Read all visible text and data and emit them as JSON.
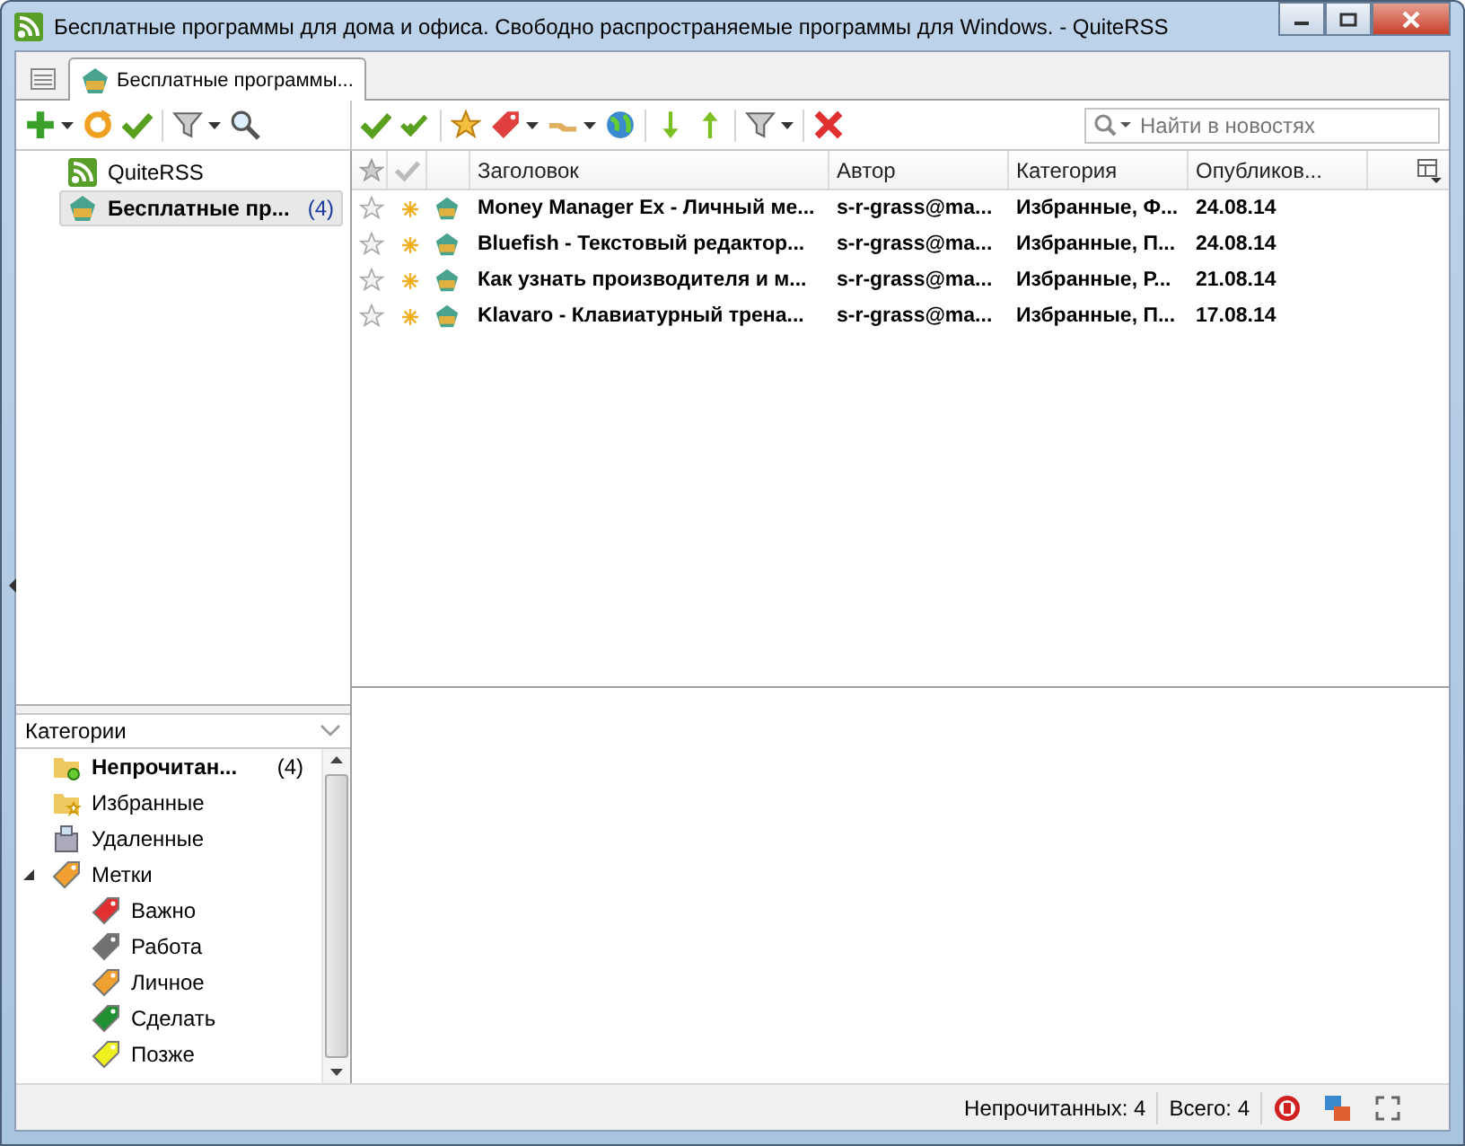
{
  "window": {
    "title": "Бесплатные программы для дома и офиса. Свободно распространяемые программы для Windows. - QuiteRSS"
  },
  "tabs": [
    {
      "label": "Бесплатные программы...",
      "selected": true
    }
  ],
  "search": {
    "placeholder": "Найти в новостях"
  },
  "feeds": [
    {
      "title": "QuiteRSS",
      "kind": "rss",
      "selected": false,
      "unread": false
    },
    {
      "title": "Бесплатные пр...",
      "count": "(4)",
      "kind": "site",
      "selected": true,
      "unread": true
    }
  ],
  "news": {
    "columns": [
      "Заголовок",
      "Автор",
      "Категория",
      "Опубликов..."
    ],
    "rows": [
      {
        "title": "Money Manager Ex - Личный ме...",
        "author": "s-r-grass@ma...",
        "category": "Избранные, Ф...",
        "date": "24.08.14",
        "starred": false,
        "unread": true
      },
      {
        "title": "Bluefish - Текстовый редактор...",
        "author": "s-r-grass@ma...",
        "category": "Избранные, П...",
        "date": "24.08.14",
        "starred": false,
        "unread": true
      },
      {
        "title": "Как узнать производителя и м...",
        "author": "s-r-grass@ma...",
        "category": "Избранные, Р...",
        "date": "21.08.14",
        "starred": false,
        "unread": true
      },
      {
        "title": "Klavaro - Клавиатурный трена...",
        "author": "s-r-grass@ma...",
        "category": "Избранные, П...",
        "date": "17.08.14",
        "starred": false,
        "unread": true
      }
    ]
  },
  "categories": {
    "header": "Категории",
    "items": [
      {
        "label": "Непрочитан...",
        "count": "(4)",
        "kind": "unread",
        "bold": true
      },
      {
        "label": "Избранные",
        "kind": "starred",
        "bold": false
      },
      {
        "label": "Удаленные",
        "kind": "deleted",
        "bold": false
      },
      {
        "label": "Метки",
        "kind": "tag",
        "color": "#f0a030",
        "bold": false,
        "expanded": true,
        "children": [
          {
            "label": "Важно",
            "kind": "tag",
            "color": "#e03030"
          },
          {
            "label": "Работа",
            "kind": "tag",
            "color": "#707070"
          },
          {
            "label": "Личное",
            "kind": "tag",
            "color": "#f0a030"
          },
          {
            "label": "Сделать",
            "kind": "tag",
            "color": "#209030"
          },
          {
            "label": "Позже",
            "kind": "tag",
            "color": "#f0f020"
          }
        ]
      }
    ]
  },
  "status_bar": {
    "unread": "Непрочитанных: 4",
    "total": "Всего: 4"
  }
}
